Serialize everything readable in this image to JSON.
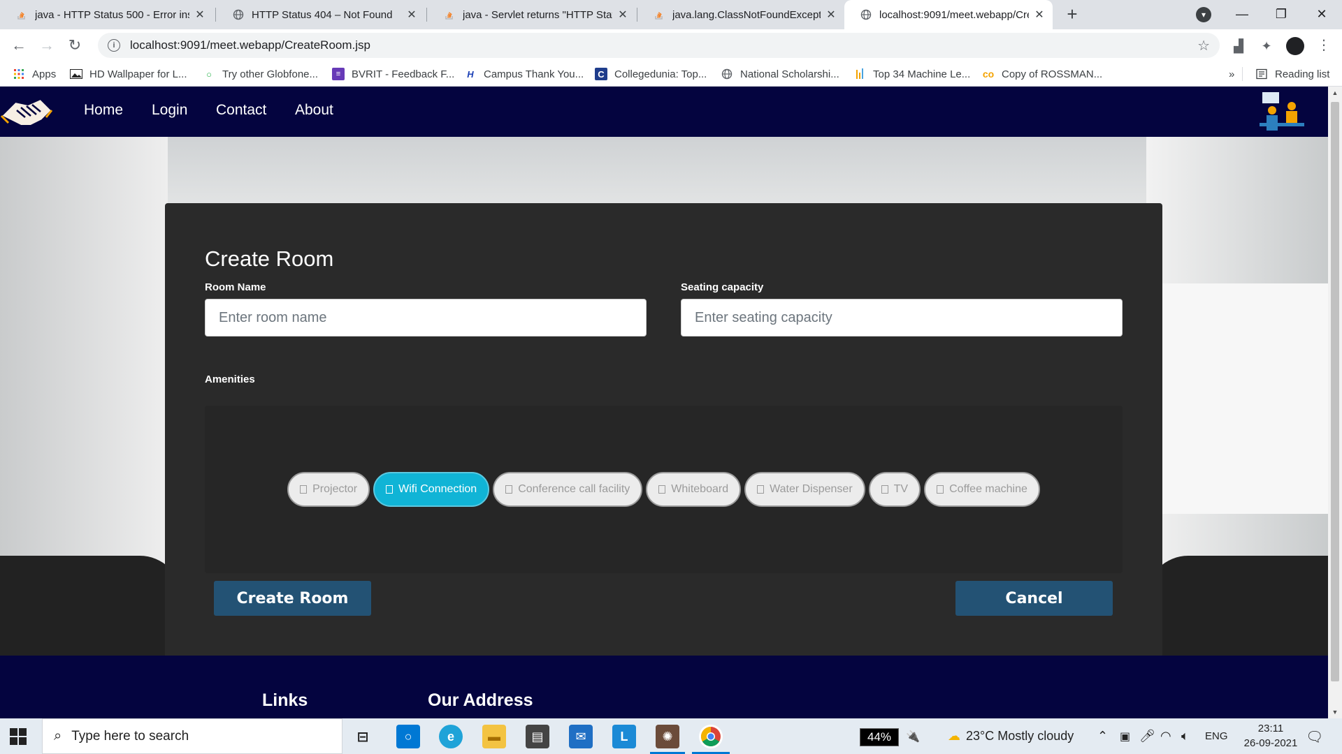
{
  "browser": {
    "tabs": [
      {
        "title": "java - HTTP Status 500 - Error ins",
        "icon": "stackoverflow-icon",
        "active": false
      },
      {
        "title": "HTTP Status 404 – Not Found",
        "icon": "globe-icon",
        "active": false
      },
      {
        "title": "java - Servlet returns \"HTTP Statu",
        "icon": "stackoverflow-icon",
        "active": false
      },
      {
        "title": "java.lang.ClassNotFoundExceptio",
        "icon": "stackoverflow-icon",
        "active": false
      },
      {
        "title": "localhost:9091/meet.webapp/Cre",
        "icon": "globe-icon",
        "active": true
      }
    ],
    "url": "localhost:9091/meet.webapp/CreateRoom.jsp",
    "bookmarks": [
      {
        "label": "Apps",
        "icon": "apps-grid-icon"
      },
      {
        "label": "HD Wallpaper for L...",
        "icon": "image-icon"
      },
      {
        "label": "Try other Globfone...",
        "icon": "globfone-icon"
      },
      {
        "label": "BVRIT - Feedback F...",
        "icon": "forms-icon"
      },
      {
        "label": "Campus Thank You...",
        "icon": "h-icon"
      },
      {
        "label": "Collegedunia: Top...",
        "icon": "c-icon"
      },
      {
        "label": "National Scholarshi...",
        "icon": "globe-icon"
      },
      {
        "label": "Top 34 Machine Le...",
        "icon": "bars-icon"
      },
      {
        "label": "Copy of ROSSMAN...",
        "icon": "co-icon"
      }
    ],
    "overflow_label": "»",
    "reading_list_label": "Reading list"
  },
  "site": {
    "nav_links": [
      "Home",
      "Login",
      "Contact",
      "About"
    ],
    "form": {
      "title": "Create Room",
      "room_name_label": "Room Name",
      "room_name_placeholder": "Enter room name",
      "room_name_value": "",
      "capacity_label": "Seating capacity",
      "capacity_placeholder": "Enter seating capacity",
      "capacity_value": "",
      "amenities_label": "Amenities",
      "amenities": [
        {
          "label": "Projector",
          "selected": false
        },
        {
          "label": "Wifi Connection",
          "selected": true
        },
        {
          "label": "Conference call facility",
          "selected": false
        },
        {
          "label": "Whiteboard",
          "selected": false
        },
        {
          "label": "Water Dispenser",
          "selected": false
        },
        {
          "label": "TV",
          "selected": false
        },
        {
          "label": "Coffee machine",
          "selected": false
        }
      ],
      "submit_label": "Create Room",
      "cancel_label": "Cancel"
    },
    "footer": {
      "links_heading": "Links",
      "address_heading": "Our Address"
    },
    "colors": {
      "navbar": "#04043f",
      "card": "#2a2a2a",
      "button": "#235274",
      "chip_selected": "#10b4d6"
    }
  },
  "taskbar": {
    "search_placeholder": "Type here to search",
    "battery": "44%",
    "weather": "23°C  Mostly cloudy",
    "language": "ENG",
    "time": "23:11",
    "date": "26-09-2021"
  }
}
